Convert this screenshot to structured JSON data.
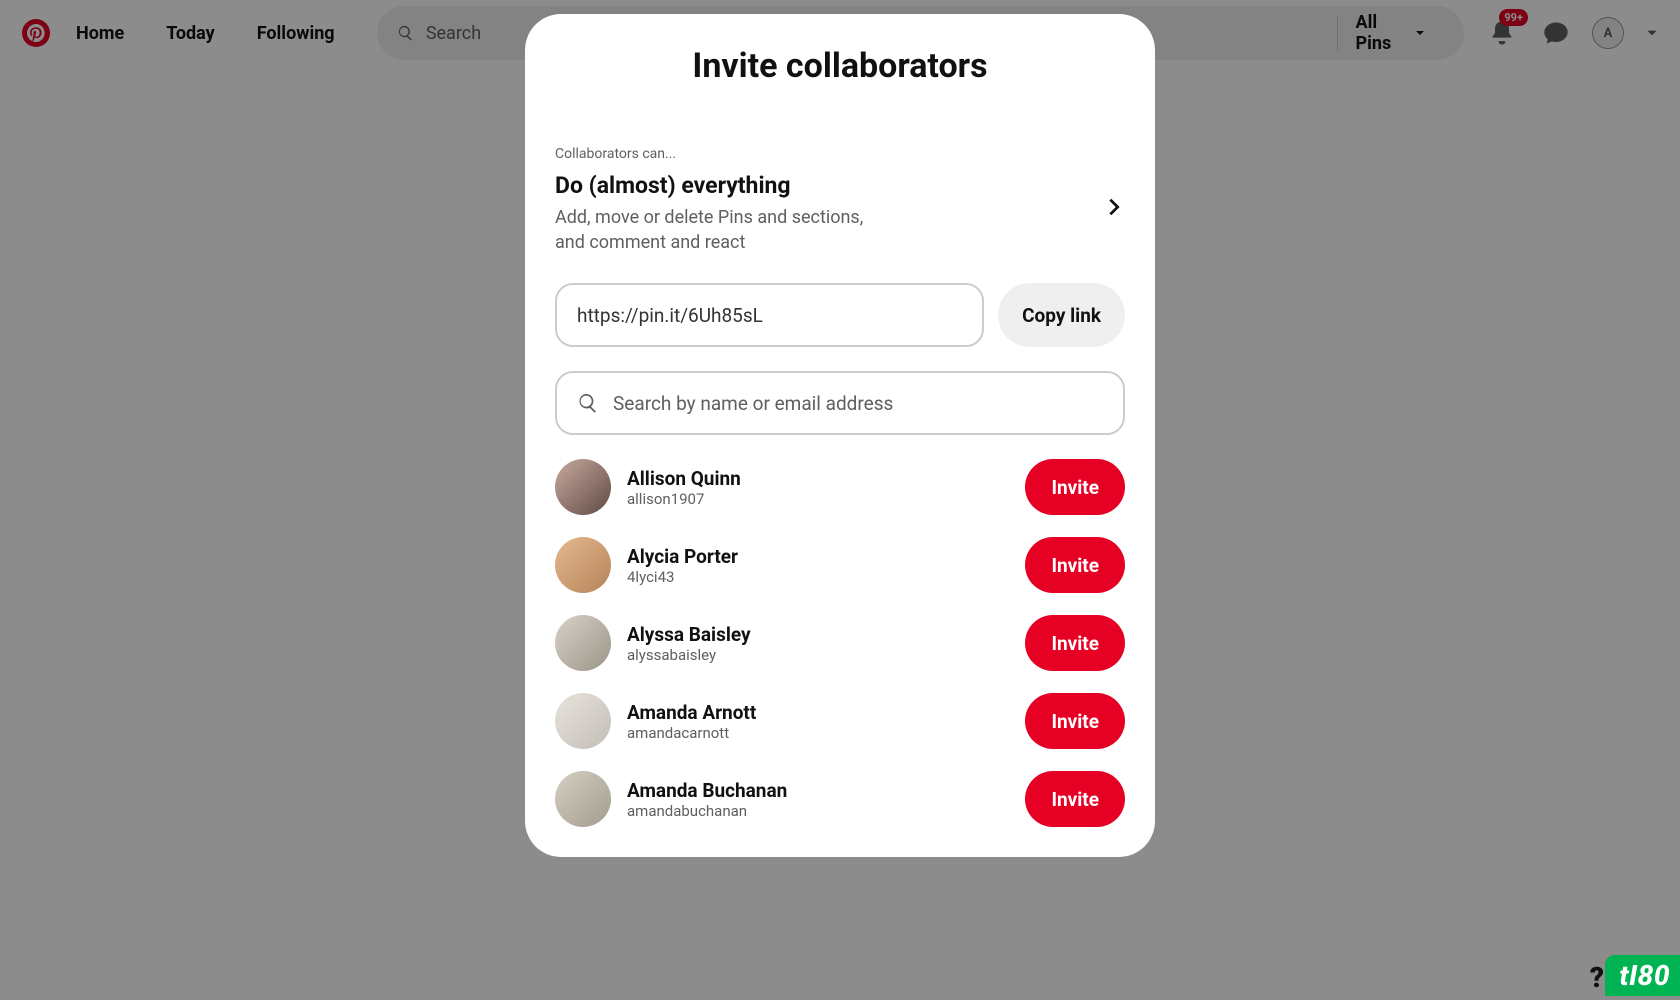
{
  "header": {
    "nav": {
      "home": "Home",
      "today": "Today",
      "following": "Following"
    },
    "search_placeholder": "Search",
    "all_pins_label": "All Pins",
    "notif_badge": "99+",
    "avatar_initial": "A"
  },
  "modal": {
    "title": "Invite collaborators",
    "permissions": {
      "label": "Collaborators can...",
      "title": "Do (almost) everything",
      "description": "Add, move or delete Pins and sections, and comment and react"
    },
    "share_link": "https://pin.it/6Uh85sL",
    "copy_label": "Copy link",
    "search_contacts_placeholder": "Search by name or email address",
    "invite_label": "Invite",
    "contacts": [
      {
        "name": "Allison Quinn",
        "handle": "allison1907"
      },
      {
        "name": "Alycia Porter",
        "handle": "4lyci43"
      },
      {
        "name": "Alyssa Baisley",
        "handle": "alyssabaisley"
      },
      {
        "name": "Amanda Arnott",
        "handle": "amandacarnott"
      },
      {
        "name": "Amanda Buchanan",
        "handle": "amandabuchanan"
      }
    ]
  },
  "footer": {
    "watermark": "tI80",
    "help": "?"
  }
}
